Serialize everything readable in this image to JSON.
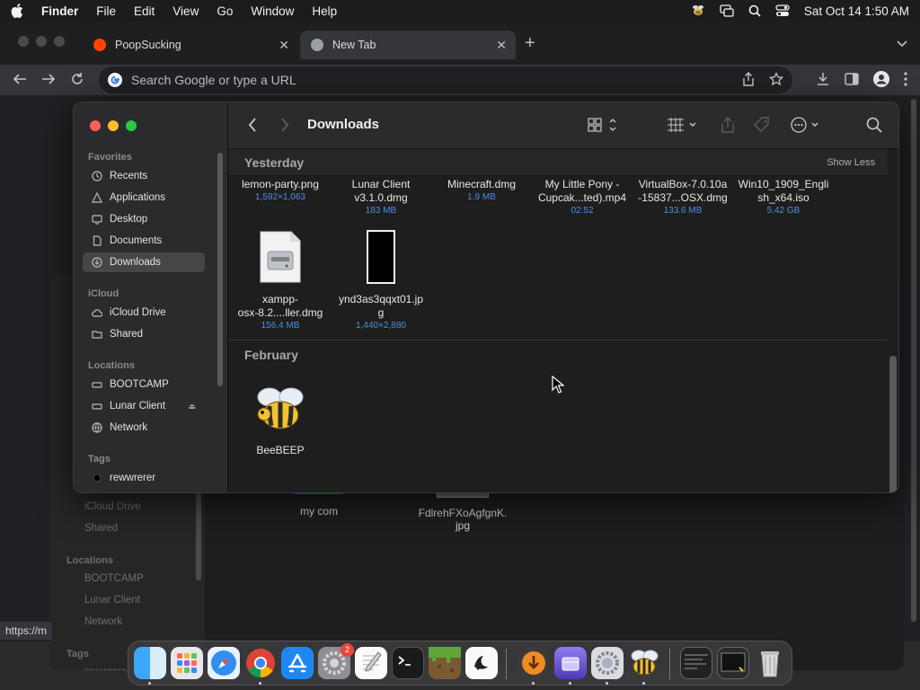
{
  "menubar": {
    "app": "Finder",
    "items": [
      "File",
      "Edit",
      "View",
      "Go",
      "Window",
      "Help"
    ],
    "clock": "Sat Oct 14  1:50 AM"
  },
  "browser": {
    "tabs": [
      {
        "title": "PoopSucking",
        "favicon": "reddit-icon",
        "color": "#ff4500"
      },
      {
        "title": "New Tab",
        "favicon": "chrome-icon",
        "color": "#9aa0a6"
      }
    ],
    "omnibox_placeholder": "Search Google or type a URL",
    "status_url": "https://m"
  },
  "finder": {
    "title": "Downloads",
    "sidebar": {
      "favorites_label": "Favorites",
      "favorites": [
        {
          "label": "Recents",
          "icon": "clock-icon"
        },
        {
          "label": "Applications",
          "icon": "applications-icon"
        },
        {
          "label": "Desktop",
          "icon": "desktop-icon"
        },
        {
          "label": "Documents",
          "icon": "document-icon"
        },
        {
          "label": "Downloads",
          "icon": "download-icon",
          "selected": true
        }
      ],
      "icloud_label": "iCloud",
      "icloud": [
        {
          "label": "iCloud Drive",
          "icon": "cloud-icon"
        },
        {
          "label": "Shared",
          "icon": "shared-folder-icon"
        }
      ],
      "locations_label": "Locations",
      "locations": [
        {
          "label": "BOOTCAMP",
          "icon": "disk-icon"
        },
        {
          "label": "Lunar Client",
          "icon": "disk-icon",
          "eject": true
        },
        {
          "label": "Network",
          "icon": "network-icon"
        }
      ],
      "tags_label": "Tags",
      "tags": [
        {
          "label": "rewwrerer",
          "color": "#000000"
        }
      ]
    },
    "groups": [
      {
        "label": "Yesterday",
        "action": "Show Less",
        "files": [
          {
            "name": "lemon-party.png",
            "meta": "1,592×1,063"
          },
          {
            "name": "Lunar Client v3.1.0.dmg",
            "name_lines": [
              "Lunar Client",
              "v3.1.0.dmg"
            ],
            "meta": "183 MB"
          },
          {
            "name": "Minecraft.dmg",
            "meta": "1.9 MB"
          },
          {
            "name": "My Little Pony - Cupcak...ted).mp4",
            "name_lines": [
              "My Little Pony -",
              "Cupcak...ted).mp4"
            ],
            "meta": "02:52"
          },
          {
            "name": "VirtualBox-7.0.10a-15837...OSX.dmg",
            "name_lines": [
              "VirtualBox-7.0.10a",
              "-15837...OSX.dmg"
            ],
            "meta": "133.6 MB"
          },
          {
            "name": "Win10_1909_English_x64.iso",
            "name_lines": [
              "Win10_1909_Engli",
              "sh_x64.iso"
            ],
            "meta": "5.42 GB"
          },
          {
            "name": "xampp-osx-8.2....ller.dmg",
            "name_lines": [
              "xampp-",
              "osx-8.2....ller.dmg"
            ],
            "meta": "156.4 MB"
          },
          {
            "name": "ynd3as3qqxt01.jpg",
            "name_lines": [
              "ynd3as3qqxt01.jp",
              "g"
            ],
            "meta": "1,440×2,880"
          }
        ]
      },
      {
        "label": "February",
        "files": [
          {
            "name": "BeeBEEP",
            "meta": ""
          }
        ]
      }
    ]
  },
  "background_finder": {
    "sidebar": {
      "icloud": [
        "iCloud Drive",
        "Shared"
      ],
      "locations_label": "Locations",
      "locations": [
        "BOOTCAMP",
        "Lunar Client",
        "Network"
      ],
      "tags_label": "Tags",
      "tags": [
        "rewwrerer"
      ]
    },
    "files": [
      {
        "name": "my com"
      },
      {
        "name_lines": [
          "FdlrehFXoAgfgnK.",
          "jpg"
        ]
      }
    ]
  },
  "dock": {
    "apps": [
      {
        "name": "Finder",
        "icon": "finder-icon",
        "running": true
      },
      {
        "name": "Launchpad",
        "icon": "launchpad-icon"
      },
      {
        "name": "Safari",
        "icon": "safari-icon"
      },
      {
        "name": "Chrome",
        "icon": "chrome-icon",
        "running": true
      },
      {
        "name": "App Store",
        "icon": "app-store-icon"
      },
      {
        "name": "System Preferences",
        "icon": "settings-icon",
        "badge": "2"
      },
      {
        "name": "TextEdit",
        "icon": "textedit-icon"
      },
      {
        "name": "Terminal",
        "icon": "terminal-icon"
      },
      {
        "name": "Minecraft",
        "icon": "minecraft-icon"
      },
      {
        "name": "Lunar Client",
        "icon": "lunar-client-icon"
      },
      {
        "name": "Downloads",
        "icon": "downloader-icon",
        "running": true
      },
      {
        "name": "Installer",
        "icon": "installer-icon",
        "running": true
      },
      {
        "name": "System Settings",
        "icon": "settings-gear-icon",
        "running": true
      },
      {
        "name": "BeeBEEP",
        "icon": "bee-icon",
        "running": true
      },
      {
        "name": "Terminal Window",
        "icon": "terminal-window-icon"
      },
      {
        "name": "Window Preview",
        "icon": "window-preview-icon"
      },
      {
        "name": "Trash",
        "icon": "trash-icon"
      }
    ]
  }
}
